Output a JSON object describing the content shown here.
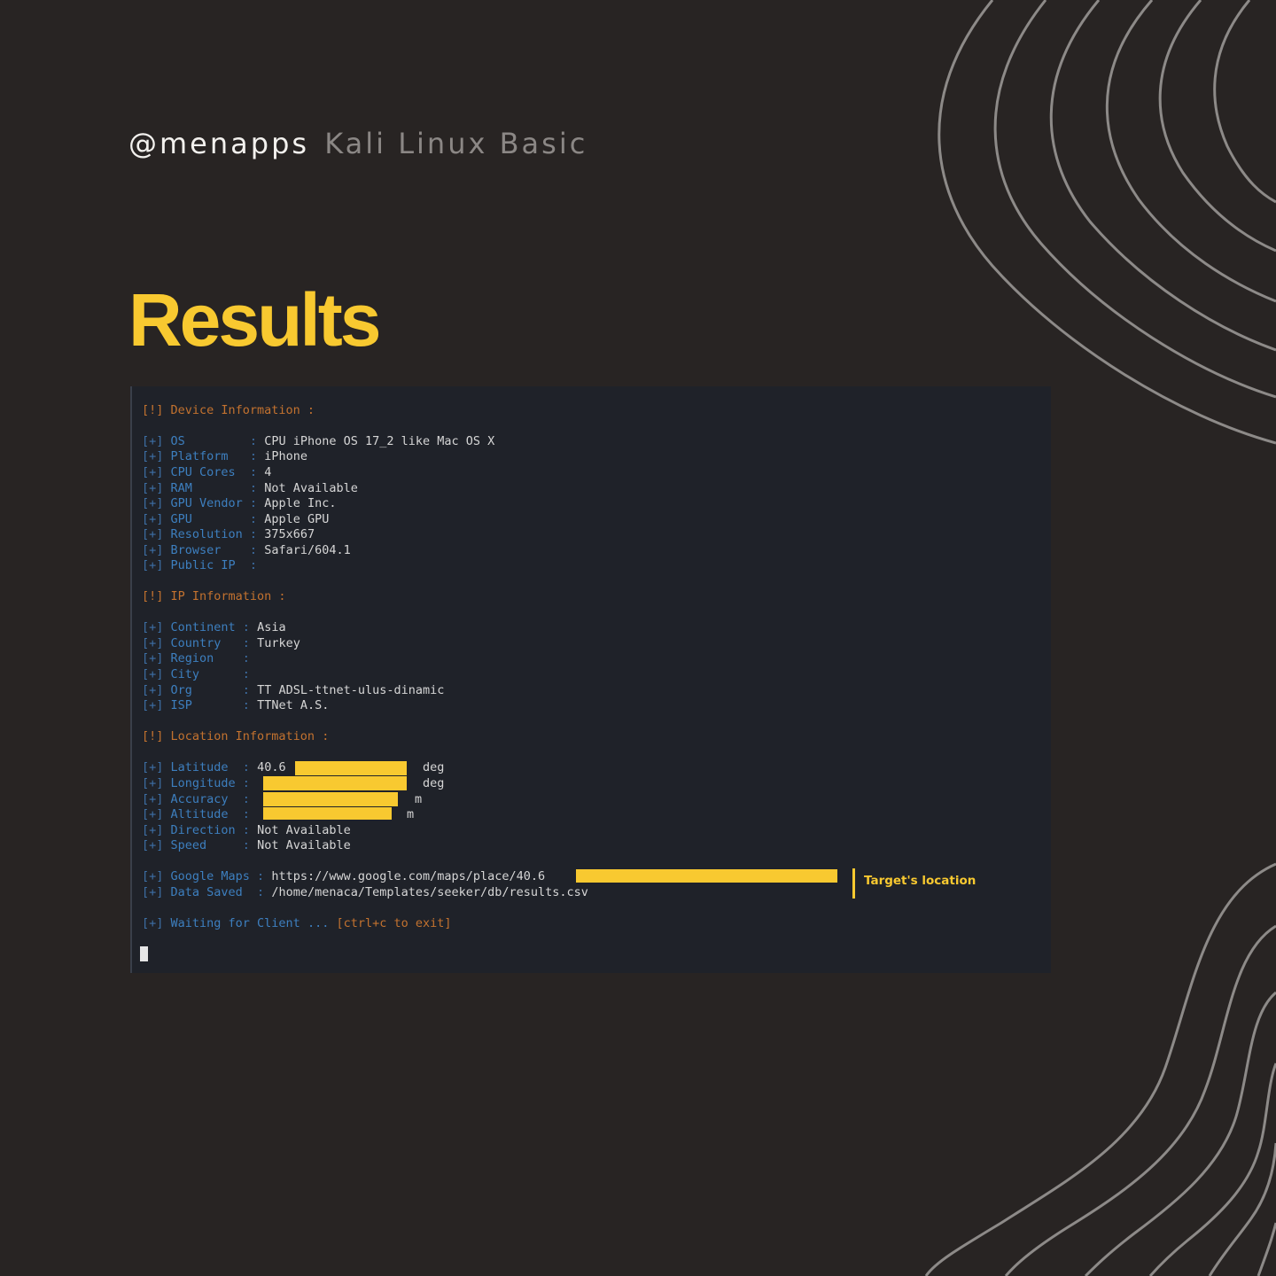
{
  "header": {
    "handle": "@menapps",
    "series": "Kali Linux Basic"
  },
  "title": "Results",
  "terminal": {
    "lines": [
      {
        "kind": "header",
        "text": "[!] Device Information :"
      },
      {
        "kind": "field",
        "key": "OS        ",
        "value": "CPU iPhone OS 17_2 like Mac OS X"
      },
      {
        "kind": "field",
        "key": "Platform  ",
        "value": "iPhone"
      },
      {
        "kind": "field",
        "key": "CPU Cores ",
        "value": "4"
      },
      {
        "kind": "field",
        "key": "RAM       ",
        "value": "Not Available"
      },
      {
        "kind": "field",
        "key": "GPU Vendor",
        "value": "Apple Inc."
      },
      {
        "kind": "field",
        "key": "GPU       ",
        "value": "Apple GPU"
      },
      {
        "kind": "field",
        "key": "Resolution",
        "value": "375x667"
      },
      {
        "kind": "field",
        "key": "Browser   ",
        "value": "Safari/604.1"
      },
      {
        "kind": "field",
        "key": "Public IP ",
        "value": ""
      },
      {
        "kind": "header",
        "text": "[!] IP Information :"
      },
      {
        "kind": "field",
        "key": "Continent",
        "value": "Asia"
      },
      {
        "kind": "field",
        "key": "Country  ",
        "value": "Turkey"
      },
      {
        "kind": "field",
        "key": "Region   ",
        "value": ""
      },
      {
        "kind": "field",
        "key": "City     ",
        "value": ""
      },
      {
        "kind": "field",
        "key": "Org      ",
        "value": "TT ADSL-ttnet-ulus-dinamic"
      },
      {
        "kind": "field",
        "key": "ISP      ",
        "value": "TTNet A.S."
      },
      {
        "kind": "header",
        "text": "[!] Location Information :"
      },
      {
        "kind": "field",
        "key": "Latitude ",
        "value": "40.6"
      },
      {
        "kind": "field",
        "key": "Longitude",
        "value": ""
      },
      {
        "kind": "field",
        "key": "Accuracy ",
        "value": ""
      },
      {
        "kind": "field",
        "key": "Altitude ",
        "value": ""
      },
      {
        "kind": "field",
        "key": "Direction",
        "value": "Not Available"
      },
      {
        "kind": "field",
        "key": "Speed    ",
        "value": "Not Available"
      },
      {
        "kind": "field",
        "key": "Google Maps",
        "value": "https://www.google.com/maps/place/40.6"
      },
      {
        "kind": "field",
        "key": "Data Saved ",
        "value": "/home/menaca/Templates/seeker/db/results.csv"
      },
      {
        "kind": "wait",
        "text": "Waiting for Client ...",
        "hint": "[ctrl+c to exit]"
      }
    ],
    "units": {
      "deg": "deg",
      "m": "m"
    },
    "annotation": "Target's location"
  }
}
